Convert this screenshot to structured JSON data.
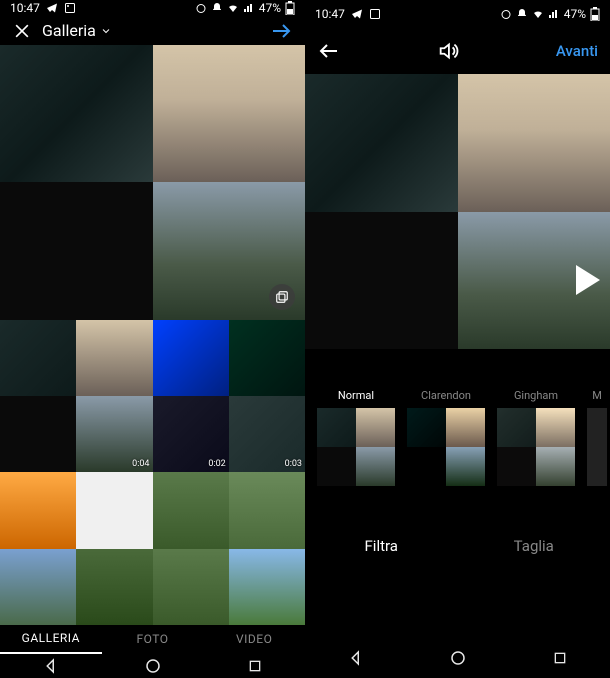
{
  "status": {
    "time": "10:47",
    "battery": "47%"
  },
  "left_screen": {
    "title": "Galleria",
    "tabs": {
      "gallery": "GALLERIA",
      "photo": "FOTO",
      "video": "VIDEO"
    },
    "durations": {
      "d1": "0:04",
      "d2": "0:02",
      "d3": "0:03"
    }
  },
  "right_screen": {
    "next_label": "Avanti",
    "filters": {
      "normal": "Normal",
      "clarendon": "Clarendon",
      "gingham": "Gingham",
      "more": "M"
    },
    "action_tabs": {
      "filter": "Filtra",
      "crop": "Taglia"
    }
  }
}
